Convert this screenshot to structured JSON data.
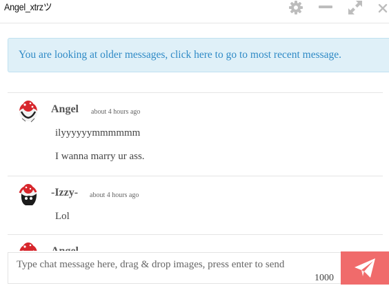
{
  "header": {
    "title": "Angel_xtrzツ",
    "icons": [
      "gear-icon",
      "minimize-icon",
      "expand-icon",
      "close-icon"
    ]
  },
  "notice": {
    "text": "You are looking at older messages, click here to go to most recent message."
  },
  "messages": [
    {
      "author": "Angel",
      "time": "about 4 hours ago",
      "lines": [
        "ilyyyyyymmmmmm",
        "I wanna marry ur ass."
      ]
    },
    {
      "author": "-Izzy-",
      "time": "about 4 hours ago",
      "lines": [
        "Lol"
      ]
    },
    {
      "author": "Angel",
      "time": "",
      "lines": []
    }
  ],
  "composer": {
    "placeholder": "Type chat message here, drag & drop images, press enter to send",
    "char_limit": "1000"
  },
  "colors": {
    "notice_bg": "#dff0f8",
    "notice_text": "#2f8ac6",
    "send_button": "#f06b6b",
    "icon_gray": "#bdbdbd"
  }
}
